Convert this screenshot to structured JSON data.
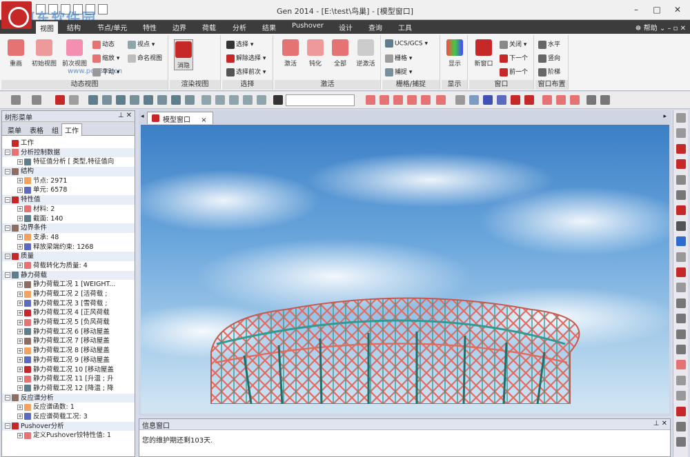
{
  "app": {
    "title": "Gen 2014 - [E:\\test\\鸟巢] - [模型窗口]",
    "watermark": "河东软件园",
    "watermark_url": "www.pc0359.cn",
    "minimize": "–",
    "maximize": "□",
    "close": "✕"
  },
  "menu_tabs": [
    {
      "label": "视图"
    },
    {
      "label": "结构"
    },
    {
      "label": "节点/单元"
    },
    {
      "label": "特性"
    },
    {
      "label": "边界"
    },
    {
      "label": "荷载"
    },
    {
      "label": "分析"
    },
    {
      "label": "结果"
    },
    {
      "label": "Pushover"
    },
    {
      "label": "设计"
    },
    {
      "label": "查询"
    },
    {
      "label": "工具"
    }
  ],
  "help": {
    "label": "帮助"
  },
  "ribbon": {
    "dynamic_view": {
      "label": "动态视图",
      "redraw": "重画",
      "initial_view": "初始视图",
      "previous_view": "前次视图",
      "dynamic": "动态",
      "viewpoint": "视点",
      "zoom": "缩放",
      "pan": "平动",
      "named_view": "命名视图"
    },
    "render_view": {
      "label": "渲染视图",
      "hidden": "消隐"
    },
    "select": {
      "label": "选择",
      "select": "选择",
      "deselect": "解除选择",
      "select_previous": "选择前次"
    },
    "activate": {
      "label": "激活",
      "activate": "激活",
      "inactivate": "钝化",
      "all": "全部",
      "inverse": "逆激活"
    },
    "grid": {
      "label": "栅格/捕捉",
      "ucs": "UCS/GCS",
      "grid": "栅格",
      "snap": "捕捉"
    },
    "display": {
      "label": "显示",
      "display": "显示"
    },
    "window": {
      "label": "窗口",
      "new_window": "新窗口",
      "close": "关闭",
      "next": "下一个",
      "prev": "前一个"
    },
    "layout": {
      "label": "窗口布置",
      "horizontal": "水平",
      "vertical": "竖向",
      "cascade": "阶梯"
    }
  },
  "tree_panel": {
    "title": "树形菜单",
    "tabs": [
      "菜单",
      "表格",
      "组",
      "工作"
    ],
    "active_tab": "工作",
    "items": [
      {
        "level": 0,
        "text": "工作",
        "cat": false
      },
      {
        "level": 0,
        "text": "分析控制数据",
        "cat": true
      },
      {
        "level": 1,
        "text": "特征值分析 [ 类型,特征值向",
        "cat": false
      },
      {
        "level": 0,
        "text": "结构",
        "cat": true
      },
      {
        "level": 1,
        "text": "节点: 2971",
        "cat": false
      },
      {
        "level": 1,
        "text": "单元: 6578",
        "cat": false
      },
      {
        "level": 0,
        "text": "特性值",
        "cat": true
      },
      {
        "level": 1,
        "text": "材料: 2",
        "cat": false
      },
      {
        "level": 1,
        "text": "截面: 140",
        "cat": false
      },
      {
        "level": 0,
        "text": "边界条件",
        "cat": true
      },
      {
        "level": 1,
        "text": "支承: 48",
        "cat": false
      },
      {
        "level": 1,
        "text": "释放梁端约束: 1268",
        "cat": false
      },
      {
        "level": 0,
        "text": "质量",
        "cat": true
      },
      {
        "level": 1,
        "text": "荷载转化为质量: 4",
        "cat": false
      },
      {
        "level": 0,
        "text": "静力荷载",
        "cat": true
      },
      {
        "level": 1,
        "text": "静力荷载工况 1 [WEIGHT...",
        "cat": false
      },
      {
        "level": 1,
        "text": "静力荷载工况 2 [活荷载 ;",
        "cat": false
      },
      {
        "level": 1,
        "text": "静力荷载工况 3 [雪荷载 ;",
        "cat": false
      },
      {
        "level": 1,
        "text": "静力荷载工况 4 [正风荷载",
        "cat": false
      },
      {
        "level": 1,
        "text": "静力荷载工况 5 [负风荷载",
        "cat": false
      },
      {
        "level": 1,
        "text": "静力荷载工况 6 [移动屋盖",
        "cat": false
      },
      {
        "level": 1,
        "text": "静力荷载工况 7 [移动屋盖",
        "cat": false
      },
      {
        "level": 1,
        "text": "静力荷载工况 8 [移动屋盖",
        "cat": false
      },
      {
        "level": 1,
        "text": "静力荷载工况 9 [移动屋盖",
        "cat": false
      },
      {
        "level": 1,
        "text": "静力荷载工况 10 [移动屋盖",
        "cat": false
      },
      {
        "level": 1,
        "text": "静力荷载工况 11 [升温 ; 升",
        "cat": false
      },
      {
        "level": 1,
        "text": "静力荷载工况 12 [降温 ; 降",
        "cat": false
      },
      {
        "level": 0,
        "text": "反应谱分析",
        "cat": true
      },
      {
        "level": 1,
        "text": "反应谱函数: 1",
        "cat": false
      },
      {
        "level": 1,
        "text": "反应谱荷载工况: 3",
        "cat": false
      },
      {
        "level": 0,
        "text": "Pushover分析",
        "cat": true
      },
      {
        "level": 1,
        "text": "定义Pushover铰特性值: 1",
        "cat": false
      }
    ]
  },
  "doc": {
    "tab_label": "模型窗口",
    "tab_close": "×"
  },
  "info_panel": {
    "title": "信息窗口",
    "message": "您的维护期还剩103天."
  },
  "colors": {
    "accent": "#c62828",
    "structure": "#d86a5a",
    "teal": "#2e8b8b"
  }
}
